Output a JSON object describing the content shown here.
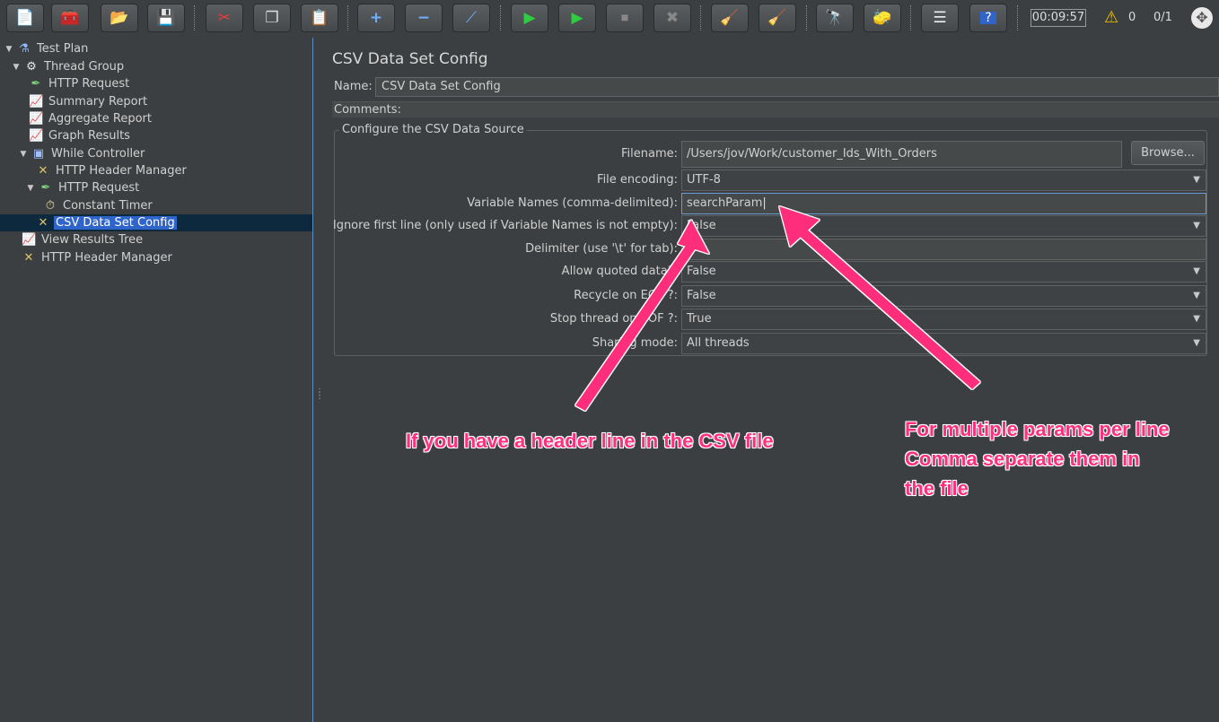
{
  "toolbar": {
    "buttons": [
      {
        "icon": "new-icon",
        "glyph": "📄"
      },
      {
        "icon": "templates-icon",
        "glyph": "🧰"
      },
      {
        "icon": "open-icon",
        "glyph": "📂"
      },
      {
        "icon": "save-icon",
        "glyph": "💾"
      },
      {
        "icon": "cut-icon",
        "glyph": "✂"
      },
      {
        "icon": "copy-icon",
        "glyph": "❐"
      },
      {
        "icon": "paste-icon",
        "glyph": "📋"
      },
      {
        "icon": "expand-icon",
        "glyph": "+"
      },
      {
        "icon": "collapse-icon",
        "glyph": "−"
      },
      {
        "icon": "toggle-icon",
        "glyph": "⟋"
      },
      {
        "icon": "start-icon",
        "glyph": "▶"
      },
      {
        "icon": "start-no-pause-icon",
        "glyph": "▶"
      },
      {
        "icon": "stop-icon",
        "glyph": "⏹"
      },
      {
        "icon": "shutdown-icon",
        "glyph": "✖"
      },
      {
        "icon": "clear-icon",
        "glyph": "🧹"
      },
      {
        "icon": "clear-all-icon",
        "glyph": "🧹"
      },
      {
        "icon": "search-icon",
        "glyph": "🔭"
      },
      {
        "icon": "reset-search-icon",
        "glyph": "🧽"
      },
      {
        "icon": "function-helper-icon",
        "glyph": "☰"
      },
      {
        "icon": "help-icon",
        "glyph": "?"
      }
    ],
    "timer": "00:09:57",
    "warning_count": "0",
    "threads": "0/1"
  },
  "tree": [
    {
      "label": "Test Plan",
      "icon": "flask-icon",
      "glyph": "⚗",
      "toggle": "▼"
    },
    {
      "label": "Thread Group",
      "icon": "gear-icon",
      "glyph": "⚙",
      "toggle": "▼"
    },
    {
      "label": "HTTP Request",
      "icon": "pipette-icon",
      "glyph": "✒",
      "toggle": ""
    },
    {
      "label": "Summary Report",
      "icon": "chart-icon",
      "glyph": "📈",
      "toggle": ""
    },
    {
      "label": "Aggregate Report",
      "icon": "chart-icon",
      "glyph": "📈",
      "toggle": ""
    },
    {
      "label": "Graph Results",
      "icon": "chart-icon",
      "glyph": "📈",
      "toggle": ""
    },
    {
      "label": "While Controller",
      "icon": "controller-icon",
      "glyph": "▣",
      "toggle": "▼"
    },
    {
      "label": "HTTP Header Manager",
      "icon": "tools-icon",
      "glyph": "✕",
      "toggle": ""
    },
    {
      "label": "HTTP Request",
      "icon": "pipette-icon",
      "glyph": "✒",
      "toggle": "▼"
    },
    {
      "label": "Constant Timer",
      "icon": "timer-icon",
      "glyph": "⏱",
      "toggle": ""
    },
    {
      "label": "CSV Data Set Config",
      "icon": "tools-icon",
      "glyph": "✕",
      "toggle": ""
    },
    {
      "label": "View Results Tree",
      "icon": "chart-icon",
      "glyph": "📈",
      "toggle": ""
    },
    {
      "label": "HTTP Header Manager",
      "icon": "tools-icon",
      "glyph": "✕",
      "toggle": ""
    }
  ],
  "panel": {
    "title": "CSV Data Set Config",
    "name_label": "Name:",
    "name_value": "CSV Data Set Config",
    "comments_label": "Comments:",
    "group_title": "Configure the CSV Data Source",
    "filename_label": "Filename:",
    "filename_value": "/Users/jov/Work/customer_Ids_With_Orders",
    "browse_label": "Browse...",
    "encoding_label": "File encoding:",
    "encoding_value": "UTF-8",
    "varnames_label": "Variable Names (comma-delimited):",
    "varnames_value": "searchParam",
    "ignore_label": "Ignore first line (only used if Variable Names is not empty):",
    "ignore_value": "False",
    "delimiter_label": "Delimiter (use '\\t' for tab):",
    "delimiter_value": "",
    "quoted_label": "Allow quoted data?:",
    "quoted_value": "False",
    "recycle_label": "Recycle on EOF ?:",
    "recycle_value": "False",
    "stop_label": "Stop thread on EOF ?:",
    "stop_value": "True",
    "sharing_label": "Sharing mode:",
    "sharing_value": "All threads"
  },
  "annotations": {
    "header_note": "If you have a header line in the CSV file",
    "multi_note_1": "For multiple params per line",
    "multi_note_2": "Comma separate them in",
    "multi_note_3": "the file",
    "color": "#ff2f7d"
  }
}
